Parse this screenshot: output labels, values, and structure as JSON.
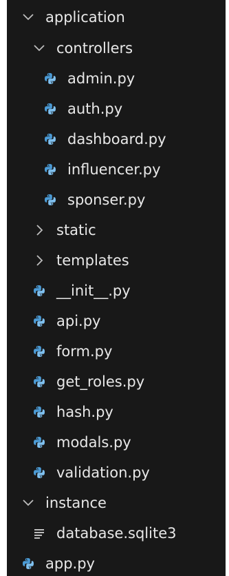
{
  "tree": {
    "application": {
      "label": "application",
      "icon": "chevron-down-icon",
      "controllers": {
        "label": "controllers",
        "icon": "chevron-down-icon",
        "files": [
          {
            "label": "admin.py",
            "icon": "python-icon"
          },
          {
            "label": "auth.py",
            "icon": "python-icon"
          },
          {
            "label": "dashboard.py",
            "icon": "python-icon"
          },
          {
            "label": "influencer.py",
            "icon": "python-icon"
          },
          {
            "label": "sponser.py",
            "icon": "python-icon"
          }
        ]
      },
      "static": {
        "label": "static",
        "icon": "chevron-right-icon"
      },
      "templates": {
        "label": "templates",
        "icon": "chevron-right-icon"
      },
      "files": [
        {
          "label": "__init__.py",
          "icon": "python-icon"
        },
        {
          "label": "api.py",
          "icon": "python-icon"
        },
        {
          "label": "form.py",
          "icon": "python-icon"
        },
        {
          "label": "get_roles.py",
          "icon": "python-icon"
        },
        {
          "label": "hash.py",
          "icon": "python-icon"
        },
        {
          "label": "modals.py",
          "icon": "python-icon"
        },
        {
          "label": "validation.py",
          "icon": "python-icon"
        }
      ]
    },
    "instance": {
      "label": "instance",
      "icon": "chevron-down-icon",
      "files": [
        {
          "label": "database.sqlite3",
          "icon": "database-file-icon"
        }
      ]
    },
    "root_files": [
      {
        "label": "app.py",
        "icon": "python-icon"
      }
    ]
  },
  "colors": {
    "background": "#181818",
    "text": "#e8e8e8",
    "chevron": "#bdbdbd",
    "python_blue": "#4b9bd6",
    "python_light": "#7fc0ef"
  }
}
